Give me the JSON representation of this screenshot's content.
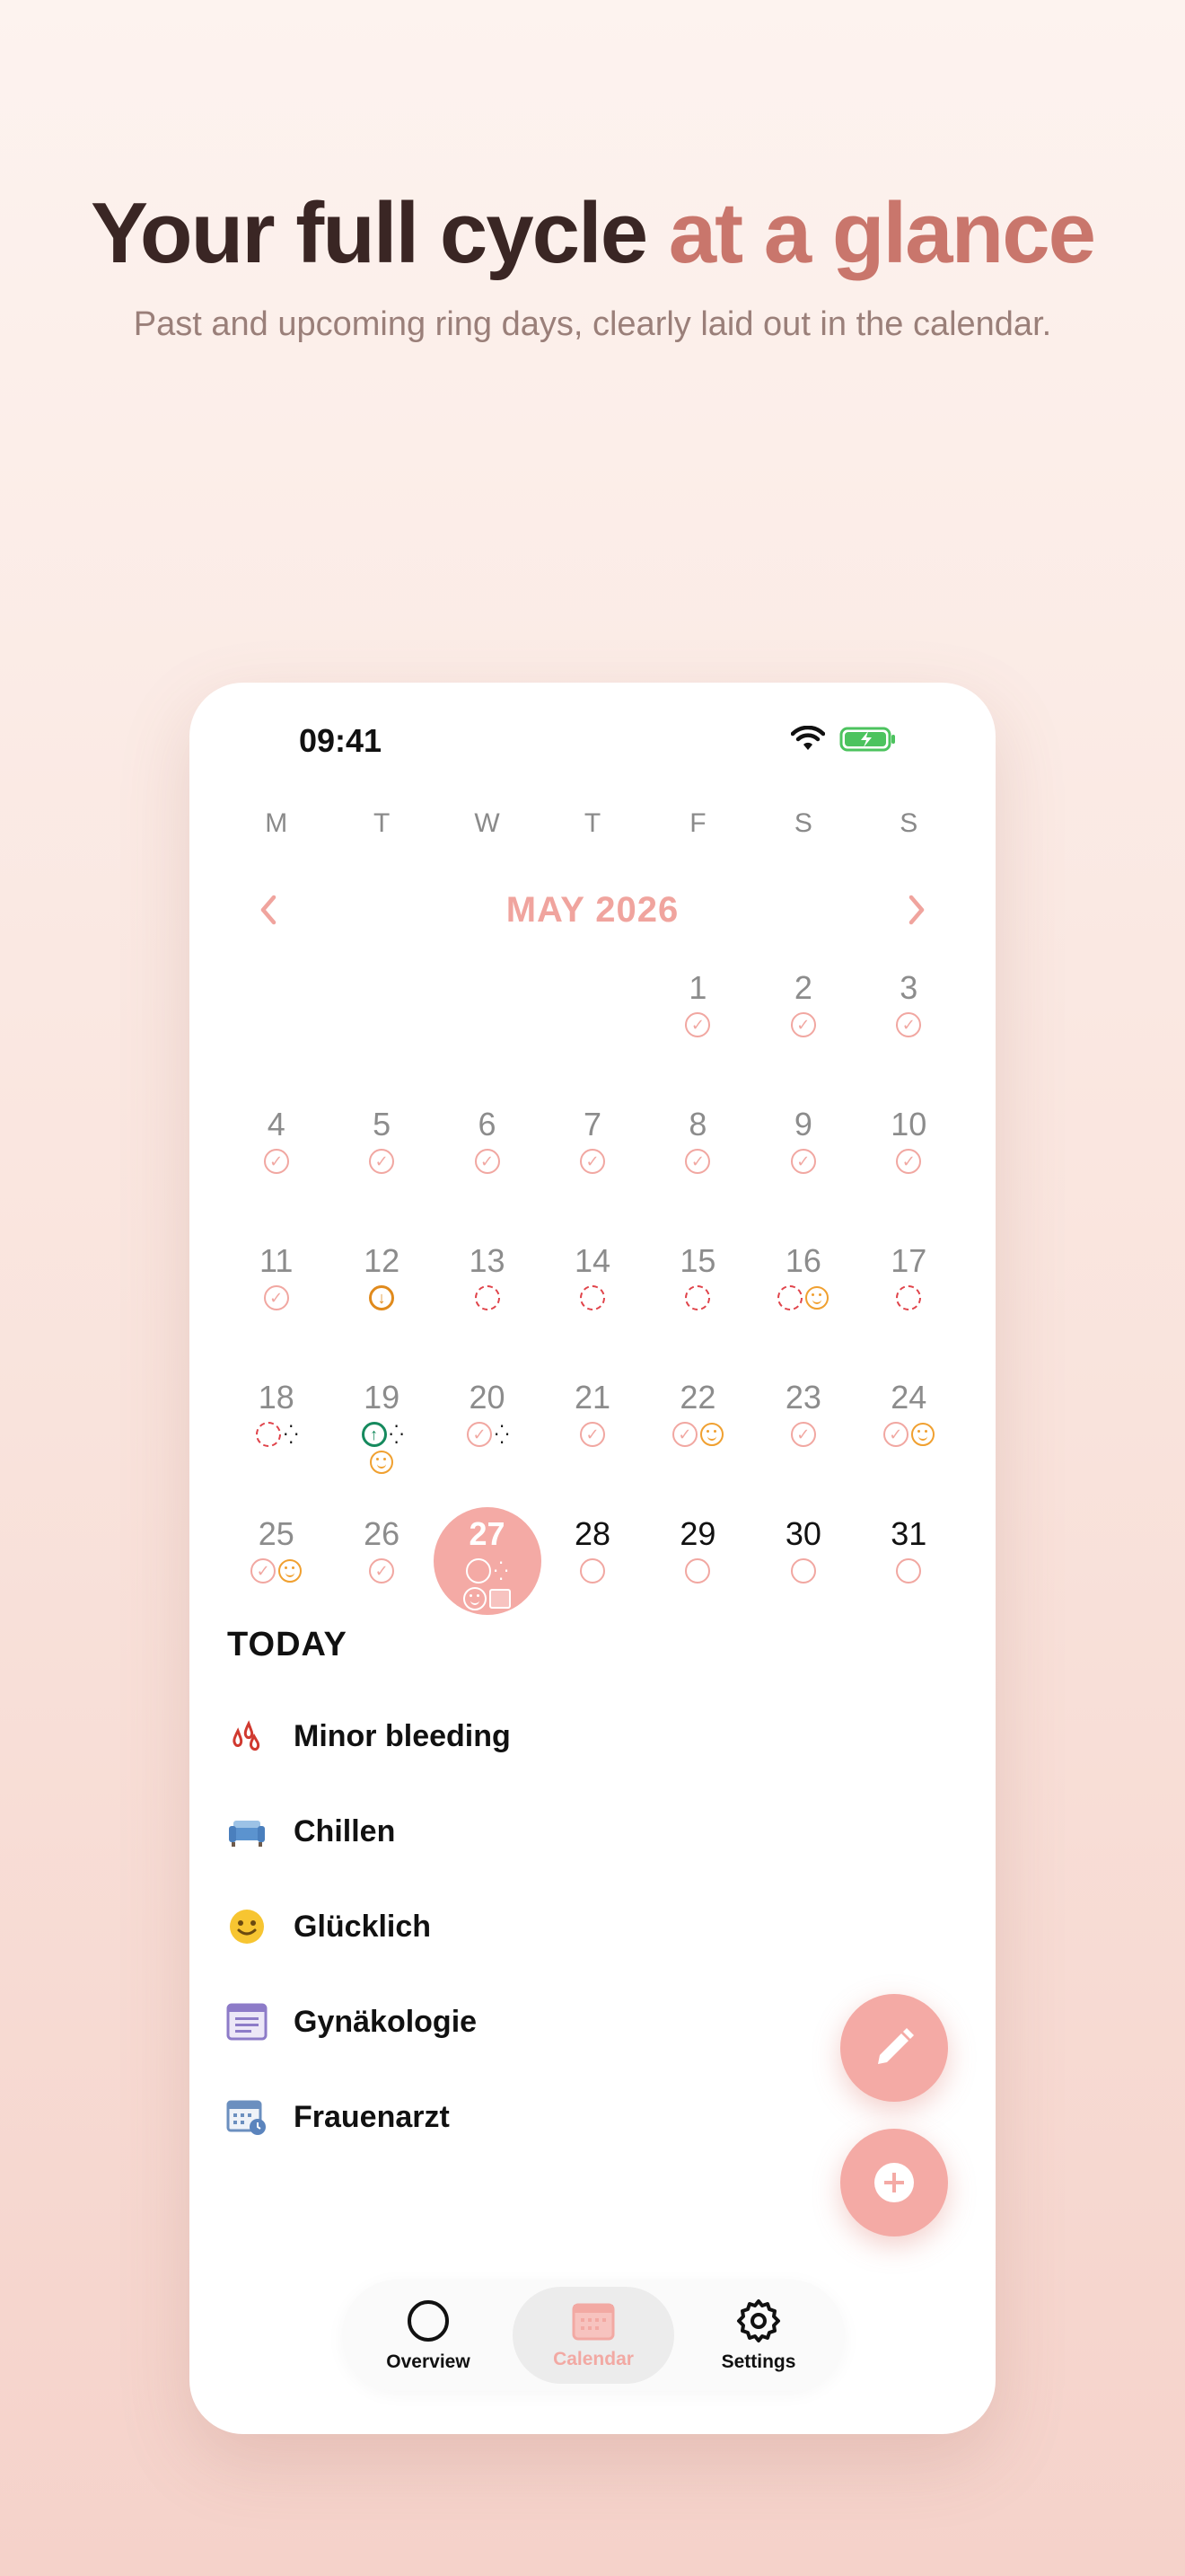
{
  "headline": {
    "main": "Your full cycle",
    "accent": "at a glance"
  },
  "subheadline": "Past and upcoming ring days, clearly laid out in the calendar.",
  "status_bar": {
    "time": "09:41"
  },
  "calendar": {
    "weekdays": [
      "M",
      "T",
      "W",
      "T",
      "F",
      "S",
      "S"
    ],
    "month_title": "MAY 2026",
    "leading_blanks": 4,
    "days": [
      {
        "d": "1",
        "marks": [
          "check"
        ]
      },
      {
        "d": "2",
        "marks": [
          "check"
        ]
      },
      {
        "d": "3",
        "marks": [
          "check"
        ]
      },
      {
        "d": "4",
        "marks": [
          "check"
        ]
      },
      {
        "d": "5",
        "marks": [
          "check"
        ]
      },
      {
        "d": "6",
        "marks": [
          "check"
        ]
      },
      {
        "d": "7",
        "marks": [
          "check"
        ]
      },
      {
        "d": "8",
        "marks": [
          "check"
        ]
      },
      {
        "d": "9",
        "marks": [
          "check"
        ]
      },
      {
        "d": "10",
        "marks": [
          "check"
        ]
      },
      {
        "d": "11",
        "marks": [
          "check"
        ]
      },
      {
        "d": "12",
        "marks": [
          "arrow-down"
        ]
      },
      {
        "d": "13",
        "marks": [
          "dash"
        ]
      },
      {
        "d": "14",
        "marks": [
          "dash"
        ]
      },
      {
        "d": "15",
        "marks": [
          "dash"
        ]
      },
      {
        "d": "16",
        "marks": [
          "dash",
          "smile"
        ]
      },
      {
        "d": "17",
        "marks": [
          "dash"
        ]
      },
      {
        "d": "18",
        "marks": [
          "dash",
          "drops"
        ]
      },
      {
        "d": "19",
        "marks": [
          "arrow-up",
          "drops"
        ],
        "marks2": [
          "smile"
        ]
      },
      {
        "d": "20",
        "marks": [
          "check",
          "drops"
        ]
      },
      {
        "d": "21",
        "marks": [
          "check"
        ]
      },
      {
        "d": "22",
        "marks": [
          "check",
          "smile"
        ]
      },
      {
        "d": "23",
        "marks": [
          "check"
        ]
      },
      {
        "d": "24",
        "marks": [
          "check",
          "smile"
        ]
      },
      {
        "d": "25",
        "marks": [
          "check",
          "smile"
        ]
      },
      {
        "d": "26",
        "marks": [
          "check"
        ]
      },
      {
        "d": "27",
        "today": true,
        "marks": [
          "white-ring",
          "sparkle"
        ],
        "marks2": [
          "white-smile",
          "note"
        ]
      },
      {
        "d": "28",
        "future": true,
        "marks": [
          "empty"
        ]
      },
      {
        "d": "29",
        "future": true,
        "marks": [
          "empty"
        ]
      },
      {
        "d": "30",
        "future": true,
        "marks": [
          "empty"
        ]
      },
      {
        "d": "31",
        "future": true,
        "marks": [
          "empty"
        ]
      }
    ]
  },
  "today_section": {
    "title": "TODAY",
    "items": [
      {
        "label": "Minor bleeding",
        "icon": "blood-drops-icon"
      },
      {
        "label": "Chillen",
        "icon": "sofa-icon"
      },
      {
        "label": "Glücklich",
        "icon": "happy-face-icon"
      },
      {
        "label": "Gynäkologie",
        "icon": "note-icon"
      },
      {
        "label": "Frauenarzt",
        "icon": "appointment-icon"
      }
    ]
  },
  "tabbar": {
    "tabs": [
      {
        "label": "Overview",
        "icon": "ring-icon"
      },
      {
        "label": "Calendar",
        "icon": "calendar-icon",
        "active": true
      },
      {
        "label": "Settings",
        "icon": "gear-icon"
      }
    ]
  },
  "colors": {
    "accent": "#f4aaa5",
    "headline_accent": "#c9766c",
    "dash_red": "#e0434a"
  }
}
